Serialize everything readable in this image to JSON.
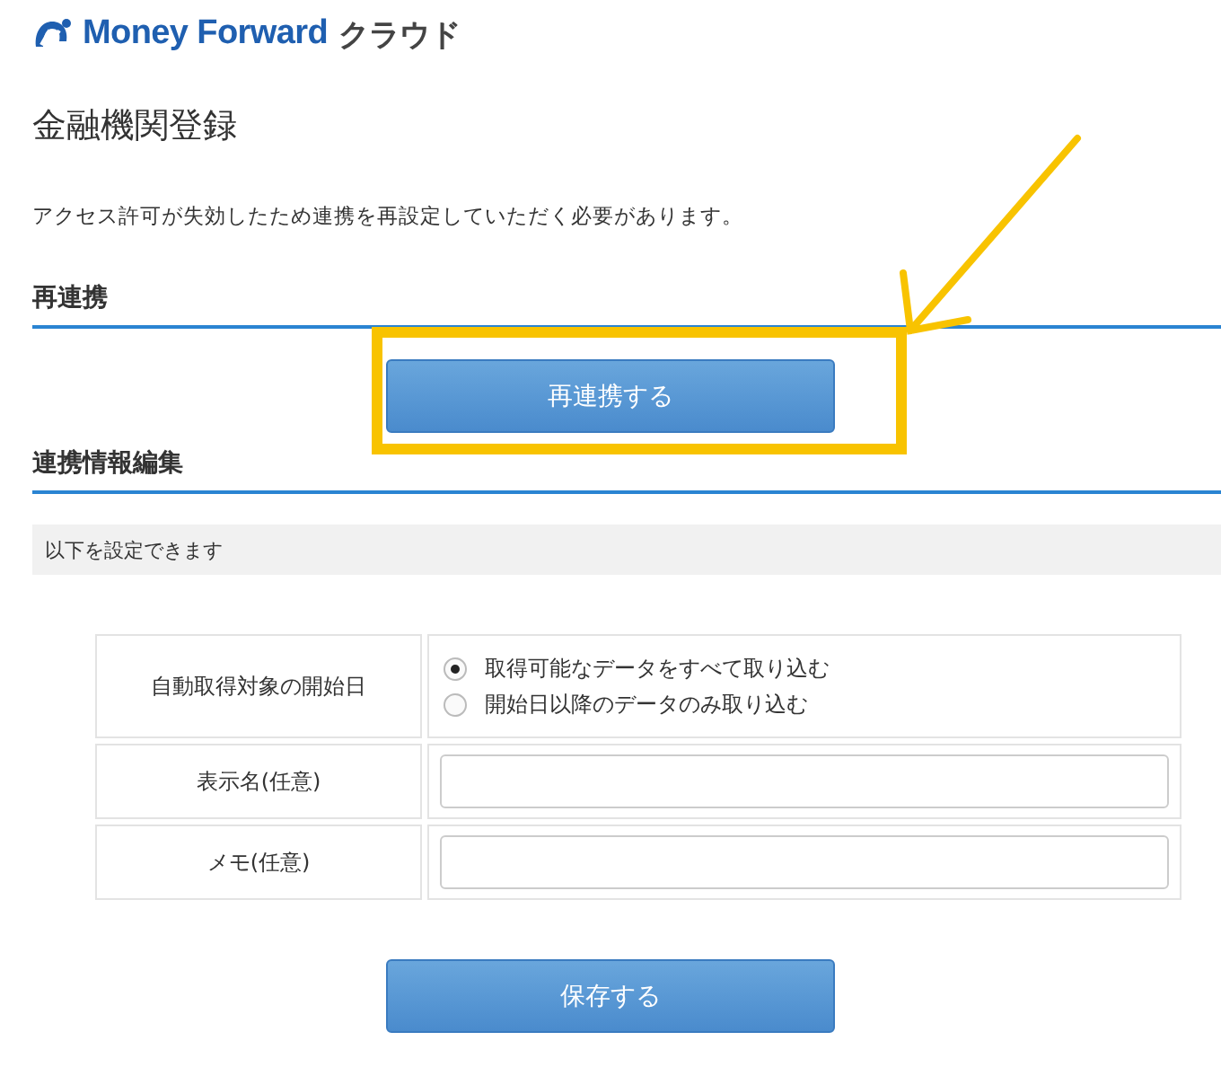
{
  "logo": {
    "brand": "Money Forward",
    "product": "クラウド"
  },
  "title": "金融機関登録",
  "notice": "アクセス許可が失効したため連携を再設定していただく必要があります。",
  "relink_section": {
    "heading": "再連携",
    "button": "再連携する"
  },
  "edit_section": {
    "heading": "連携情報編集",
    "info": "以下を設定できます",
    "rows": [
      {
        "kind": "radio",
        "label": "自動取得対象の開始日",
        "options": [
          {
            "label": "取得可能なデータをすべて取り込む",
            "selected": true
          },
          {
            "label": "開始日以降のデータのみ取り込む",
            "selected": false
          }
        ]
      },
      {
        "kind": "text",
        "label": "表示名(任意)"
      },
      {
        "kind": "text",
        "label": "メモ(任意)"
      }
    ],
    "button": "保存する"
  }
}
